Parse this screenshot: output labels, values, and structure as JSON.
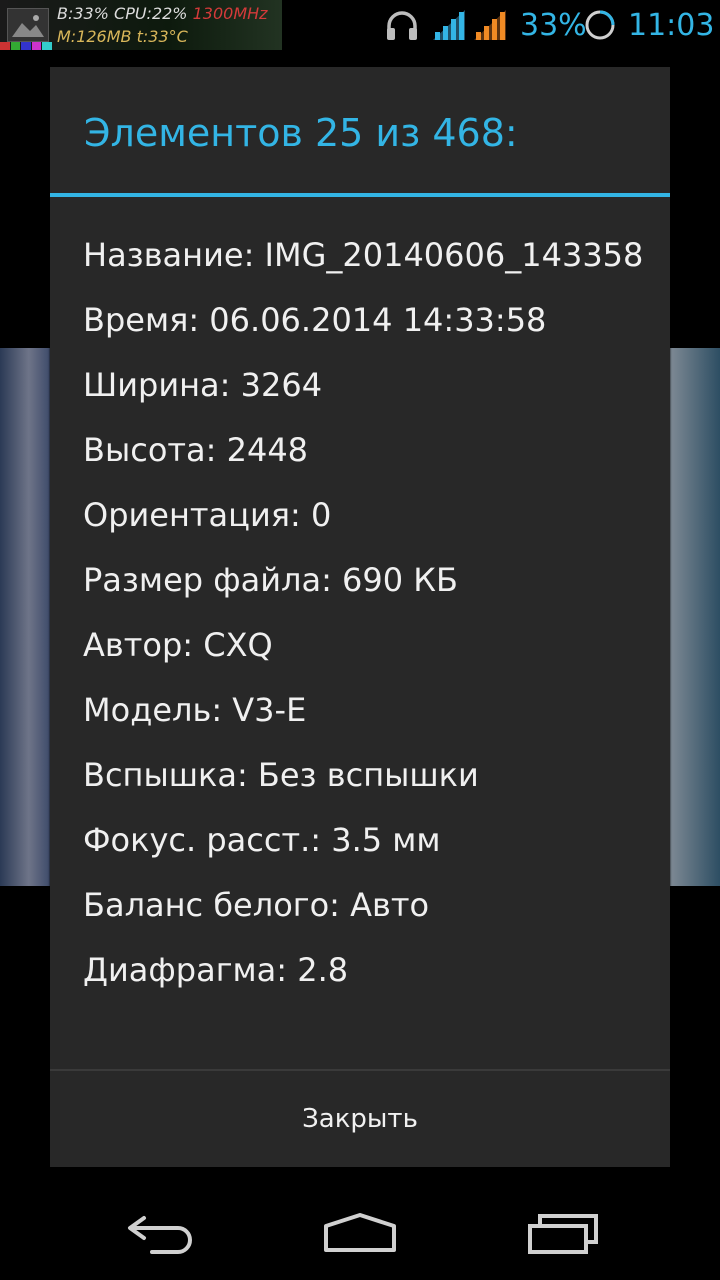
{
  "status_bar": {
    "overlay_line1_prefix": "B:33% CPU:22% ",
    "overlay_line1_mhz": "1300MHz",
    "overlay_line2": "M:126MB t:33°C",
    "battery_percent": "33%",
    "time": "11:03",
    "accent_color": "#33b5e5",
    "icons": [
      "headphones-icon",
      "wifi-signal-icon",
      "cell-signal-icon",
      "battery-ring-icon"
    ]
  },
  "dialog": {
    "title": "Элементов 25 из 468:",
    "properties": [
      "Название: IMG_20140606_143358",
      "Время: 06.06.2014 14:33:58",
      "Ширина: 3264",
      "Высота: 2448",
      "Ориентация: 0",
      "Размер файла: 690 КБ",
      "Автор: CXQ",
      "Модель: V3-E",
      "Вспышка: Без вспышки",
      "Фокус. расст.: 3.5 мм",
      "Баланс белого: Авто",
      "Диафрагма: 2.8"
    ],
    "close_label": "Закрыть"
  },
  "nav_bar": {
    "icons": [
      "back-icon",
      "home-icon",
      "recent-apps-icon"
    ]
  }
}
